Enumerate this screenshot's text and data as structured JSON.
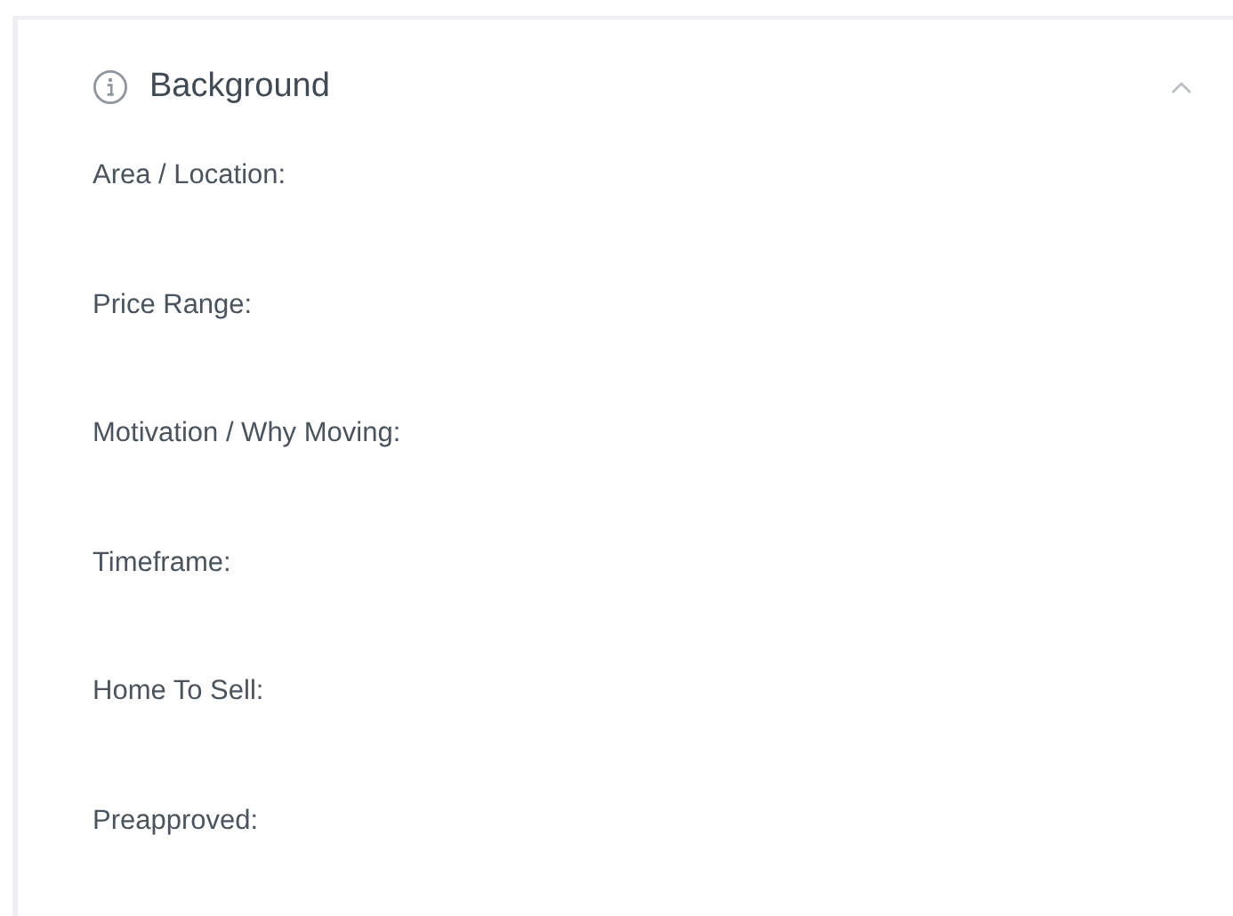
{
  "section": {
    "title": "Background",
    "expanded": true,
    "fields": [
      {
        "label": "Area / Location:"
      },
      {
        "label": "Price Range:"
      },
      {
        "label": "Motivation / Why Moving:"
      },
      {
        "label": "Timeframe:"
      },
      {
        "label": "Home To Sell:"
      },
      {
        "label": "Preapproved:"
      }
    ]
  }
}
